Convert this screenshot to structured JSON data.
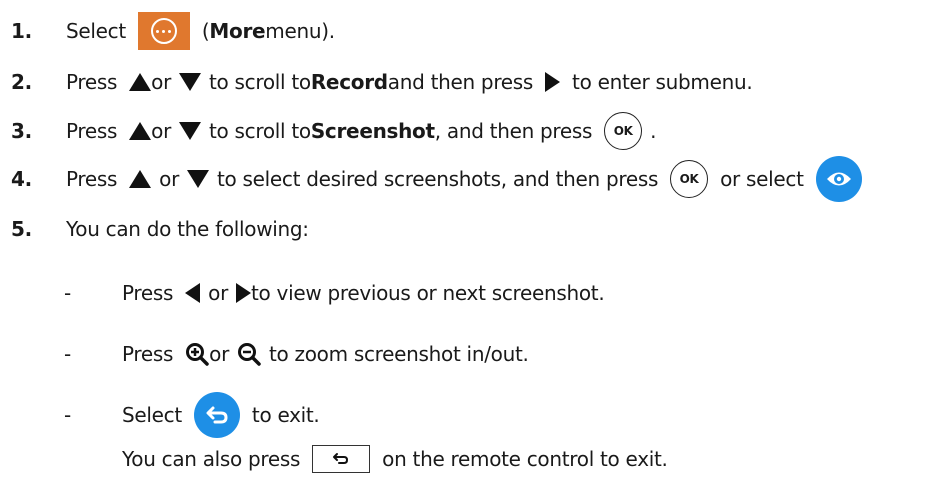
{
  "steps": [
    {
      "num": "1.",
      "p1": "Select",
      "p2": "(",
      "bold": "More",
      "p3": " menu)."
    },
    {
      "num": "2.",
      "p1": "Press",
      "or": "or",
      "p2": "to scroll to ",
      "bold": "Record",
      "p3": " and then press",
      "p4": "to enter submenu."
    },
    {
      "num": "3.",
      "p1": "Press",
      "or": "or",
      "p2": "to scroll to ",
      "bold": "Screenshot",
      "p3": ", and then press",
      "p4": "."
    },
    {
      "num": "4.",
      "p1": "Press",
      "or": "or",
      "p2": "to select desired screenshots, and then press",
      "p3": "or select"
    },
    {
      "num": "5.",
      "p1": "You can do the following:"
    }
  ],
  "sub_items": [
    {
      "dash": "-",
      "p1": "Press",
      "or": "or",
      "p2": "to view previous or next screenshot."
    },
    {
      "dash": "-",
      "p1": "Press",
      "or": "or",
      "p2": "to zoom screenshot in/out."
    },
    {
      "dash": "-",
      "p1": "Select",
      "p2": "to exit."
    }
  ],
  "remote_note": {
    "p1": "You can also press",
    "p2": "on the remote control to exit."
  },
  "buttons": {
    "ok_label": "OK"
  },
  "colors": {
    "more_orange": "#e0782e",
    "icon_blue": "#1e8fe6"
  },
  "icons": [
    "more-icon",
    "up-triangle-icon",
    "down-triangle-icon",
    "right-triangle-icon",
    "left-triangle-icon",
    "ok-button-icon",
    "view-eye-icon",
    "zoom-in-icon",
    "zoom-out-icon",
    "back-icon",
    "remote-back-icon"
  ]
}
